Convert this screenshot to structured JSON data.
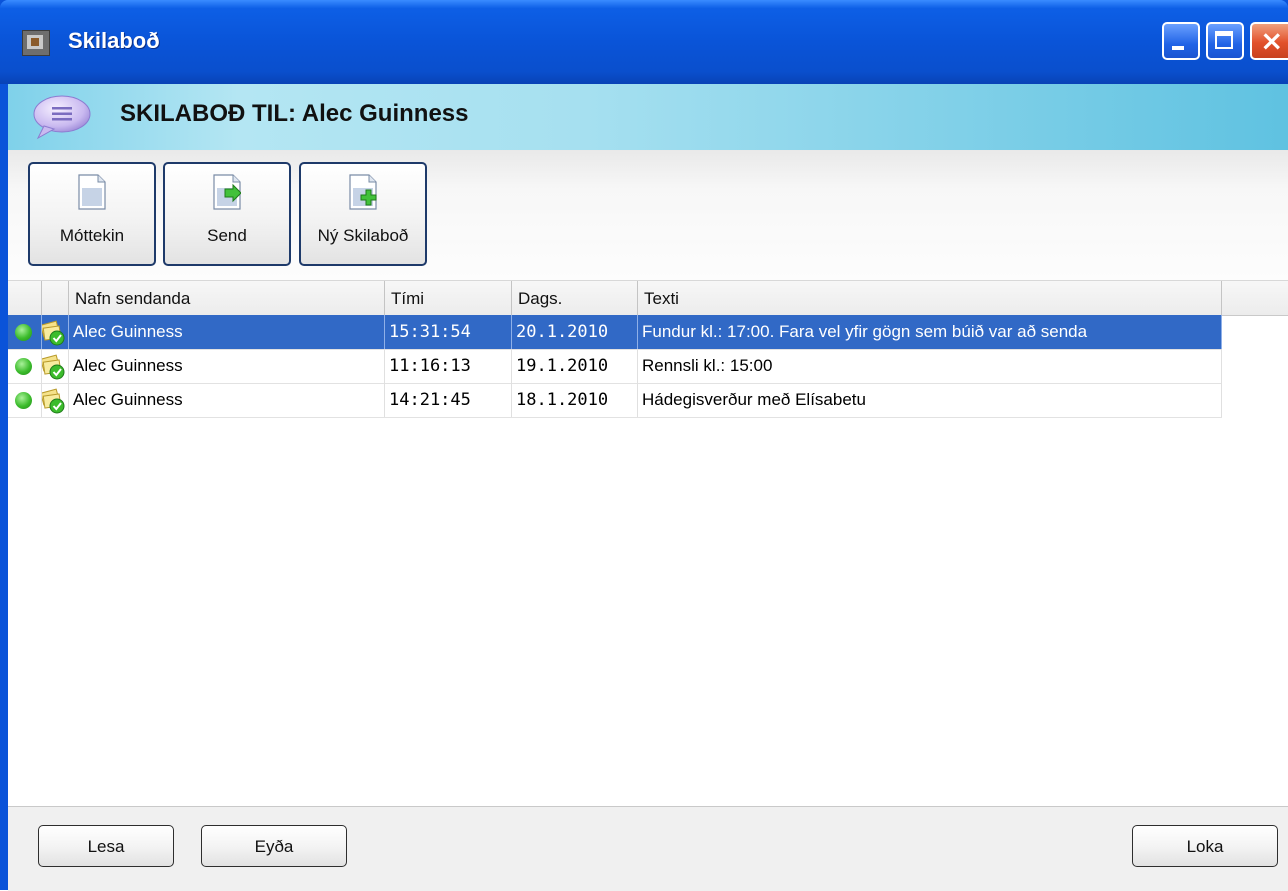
{
  "window": {
    "title": "Skilaboð",
    "controls": {
      "minimize": "minimize",
      "maximize": "maximize",
      "close": "close"
    }
  },
  "header": {
    "title": "SKILABOÐ TIL:  Alec Guinness",
    "icon": "speech-bubble-icon"
  },
  "toolbar": {
    "buttons": [
      {
        "label": "Móttekin",
        "icon": "document-icon"
      },
      {
        "label": "Send",
        "icon": "document-send-icon"
      },
      {
        "label": "Ný Skilaboð",
        "icon": "document-new-icon"
      }
    ]
  },
  "grid": {
    "columns": [
      "",
      "",
      "Nafn sendanda",
      "Tími",
      "Dags.",
      "Texti"
    ],
    "rows": [
      {
        "sender": "Alec Guinness",
        "time": "15:31:54",
        "date": "20.1.2010",
        "text": "Fundur kl.: 17:00. Fara vel yfir gögn sem búið var að senda",
        "selected": true
      },
      {
        "sender": "Alec Guinness",
        "time": "11:16:13",
        "date": "19.1.2010",
        "text": "Rennsli kl.: 15:00",
        "selected": false
      },
      {
        "sender": "Alec Guinness",
        "time": "14:21:45",
        "date": "18.1.2010",
        "text": "Hádegisverður með Elísabetu",
        "selected": false
      }
    ]
  },
  "footer": {
    "read_label": "Lesa",
    "delete_label": "Eyða",
    "close_label": "Loka"
  },
  "colors": {
    "titlebar": "#0a54d8",
    "selection": "#3169c6",
    "header_band": "#a6e0f0",
    "status_green": "#3cbc2c"
  }
}
